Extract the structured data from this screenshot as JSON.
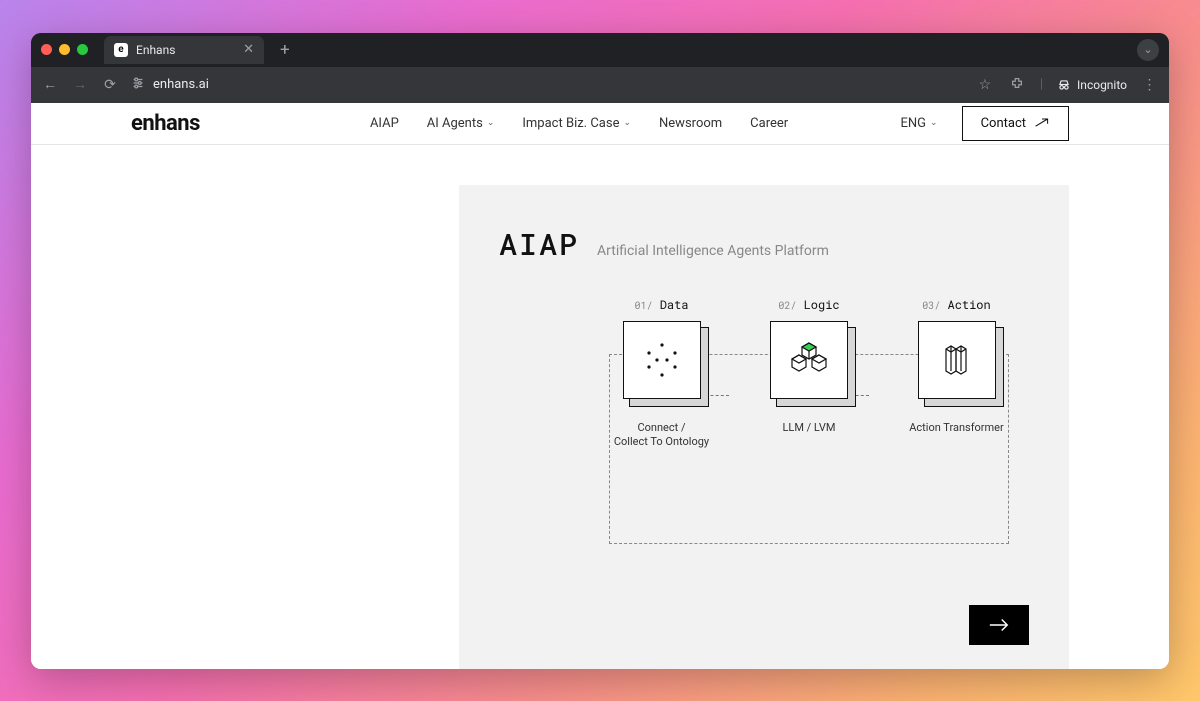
{
  "browser": {
    "tab_title": "Enhans",
    "favicon_letter": "e",
    "url": "enhans.ai",
    "incognito_label": "Incognito"
  },
  "header": {
    "logo": "enhans",
    "nav": [
      {
        "label": "AIAP",
        "dropdown": false
      },
      {
        "label": "AI Agents",
        "dropdown": true
      },
      {
        "label": "Impact Biz. Case",
        "dropdown": true
      },
      {
        "label": "Newsroom",
        "dropdown": false
      },
      {
        "label": "Career",
        "dropdown": false
      }
    ],
    "lang": "ENG",
    "contact_label": "Contact"
  },
  "hero": {
    "title": "AIAP",
    "subtitle": "Artificial Intelligence Agents Platform",
    "steps": [
      {
        "num": "01/",
        "title": "Data",
        "desc": "Connect /\nCollect To Ontology",
        "icon": "dots"
      },
      {
        "num": "02/",
        "title": "Logic",
        "desc": "LLM / LVM",
        "icon": "cubes"
      },
      {
        "num": "03/",
        "title": "Action",
        "desc": "Action Transformer",
        "icon": "servers"
      }
    ]
  }
}
